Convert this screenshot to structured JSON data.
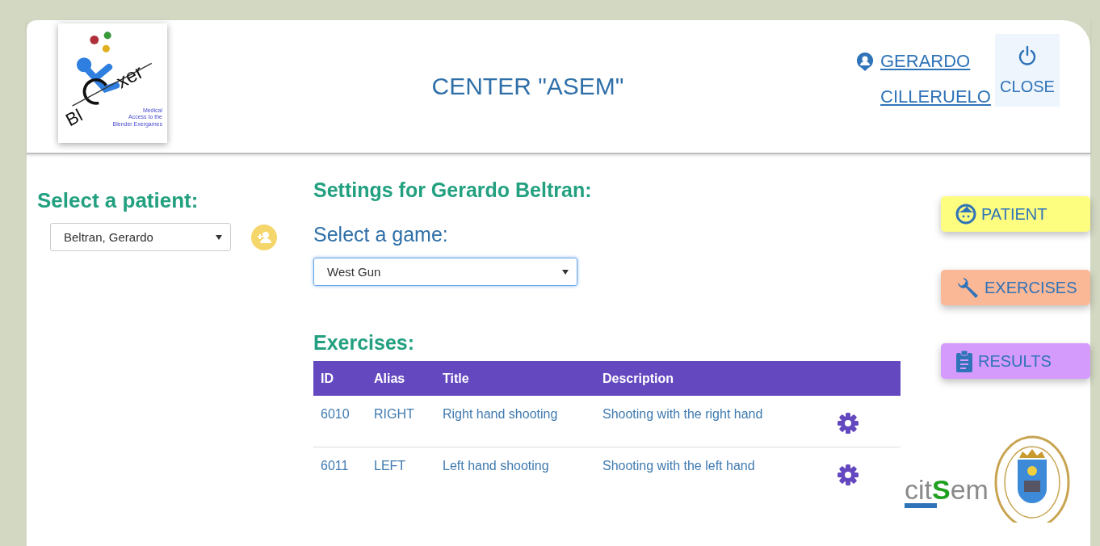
{
  "logo": {
    "wordmark_left": "Bl",
    "wordmark_right": "xer",
    "subtitle": [
      "Medical",
      "Access to the",
      "Blender Exergames"
    ]
  },
  "header": {
    "title": "CENTER \"ASEM\"",
    "user": "GERARDO CILLERUELO",
    "close": "CLOSE"
  },
  "patient_panel": {
    "heading": "Select a patient:",
    "patient": "Beltran, Gerardo"
  },
  "settings": {
    "heading": "Settings for Gerardo Beltran:",
    "game_label": "Select a game:",
    "game": "West Gun",
    "exercises_heading": "Exercises:"
  },
  "table": {
    "columns": [
      "ID",
      "Alias",
      "Title",
      "Description"
    ],
    "rows": [
      {
        "id": "6010",
        "alias": "RIGHT",
        "title": "Right hand shooting",
        "description": "Shooting with the right hand"
      },
      {
        "id": "6011",
        "alias": "LEFT",
        "title": "Left hand shooting",
        "description": "Shooting with the left hand"
      }
    ]
  },
  "nav": [
    {
      "kind": "patient",
      "label": "PATIENT",
      "color": "#fdfd80"
    },
    {
      "kind": "exercises",
      "label": "EXERCISES",
      "color": "#fbb896"
    },
    {
      "kind": "results",
      "label": "RESULTS",
      "color": "#d59bfc"
    }
  ],
  "footer_logo": {
    "left": "cit",
    "mid": "S",
    "right": "em"
  }
}
